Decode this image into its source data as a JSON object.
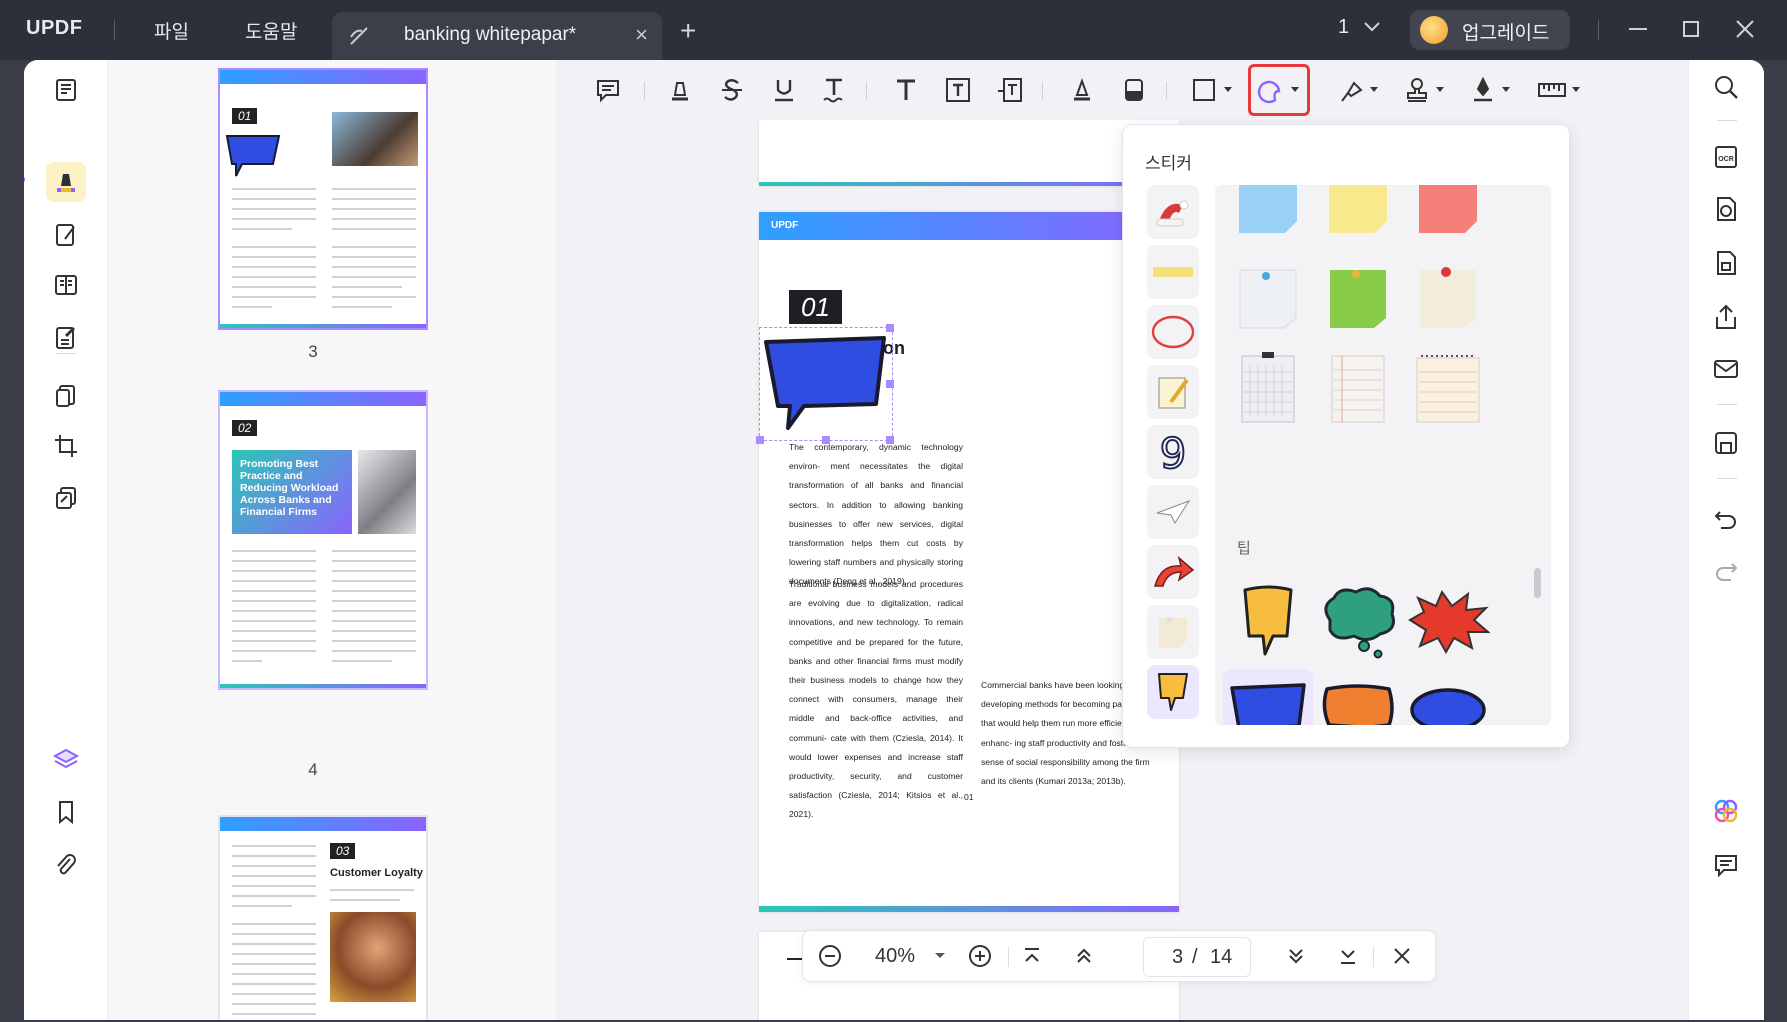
{
  "app": {
    "logo": "UPDF"
  },
  "menu": {
    "file": "파일",
    "help": "도움말"
  },
  "tab": {
    "title": "banking whitepapar*",
    "close": "×",
    "new": "+"
  },
  "topbar": {
    "page_count": "1",
    "upgrade": "업그레이드"
  },
  "thumbnails": [
    {
      "label": "3",
      "badge": "01"
    },
    {
      "label": "4",
      "badge": "02",
      "title_block": "Promoting Best Practice and Reducing Workload Across Banks and Financial Firms"
    },
    {
      "label": "",
      "badge": "03",
      "heading": "Customer Loyalty"
    }
  ],
  "toolbar": {
    "tools": [
      "comment-icon",
      "highlight-icon",
      "strikethrough-icon",
      "underline-icon",
      "squiggly-icon",
      "text-icon",
      "textbox-icon",
      "text-callout-icon",
      "pencil-icon",
      "eraser-icon",
      "shape-icon",
      "sticker-icon",
      "pin-icon",
      "stamp-icon",
      "signature-icon",
      "measure-icon"
    ],
    "active_tool": "sticker-icon"
  },
  "document": {
    "header_logo": "UPDF",
    "section_number": "01",
    "heading_fragment": "on",
    "col1_para1": "The contemporary, dynamic technology environ- ment necessitates the digital transformation of all banks and financial sectors. In addition to allowing banking businesses to offer new services, digital transformation helps them cut costs by lowering staff numbers and physically storing documents (Deng et al., 2019).",
    "col1_para2": "Traditional business models and procedures are evolving due to digitalization, radical innovations, and new technology. To remain competitive and be prepared for the future, banks and other financial firms must modify their business models to change how they connect with consumers, manage their middle and back-office activities, and communi- cate with them (Cziesla, 2014). It would lower expenses and increase staff productivity, security, and customer satisfaction (Cziesla, 2014; Kitsios et al., 2021).",
    "col2_para": "Commercial banks have been looking at and developing methods for becoming paperless that would help them run more efficiently by enhanc- ing staff productivity and fostering a sense of social responsibility among the firm and its clients (Kumari 2013a; 2013b).",
    "page_number": "01"
  },
  "navigation": {
    "zoom": "40%",
    "current_page": "3",
    "separator": "/",
    "total_pages": "14"
  },
  "sticker_panel": {
    "title": "스티커",
    "tip_label": "팁",
    "categories": [
      "santa-hat",
      "sticky-tape",
      "red-circle",
      "notepad-pencil",
      "number-nine",
      "paper-plane",
      "red-arrow",
      "sticky-note",
      "speech-bubble"
    ],
    "selected_category": "speech-bubble",
    "note_stickers": [
      "blue-note",
      "yellow-note",
      "red-note",
      "white-note-pin",
      "green-note-pin",
      "paper-note-pin",
      "grid-notepad",
      "lined-notepad",
      "spiral-notepad"
    ],
    "bubble_stickers": [
      "yellow-bubble",
      "teal-cloud-bubble",
      "red-burst",
      "blue-rect-bubble",
      "orange-bubble",
      "blue-oval-bubble"
    ],
    "selected_sticker": "blue-rect-bubble"
  }
}
